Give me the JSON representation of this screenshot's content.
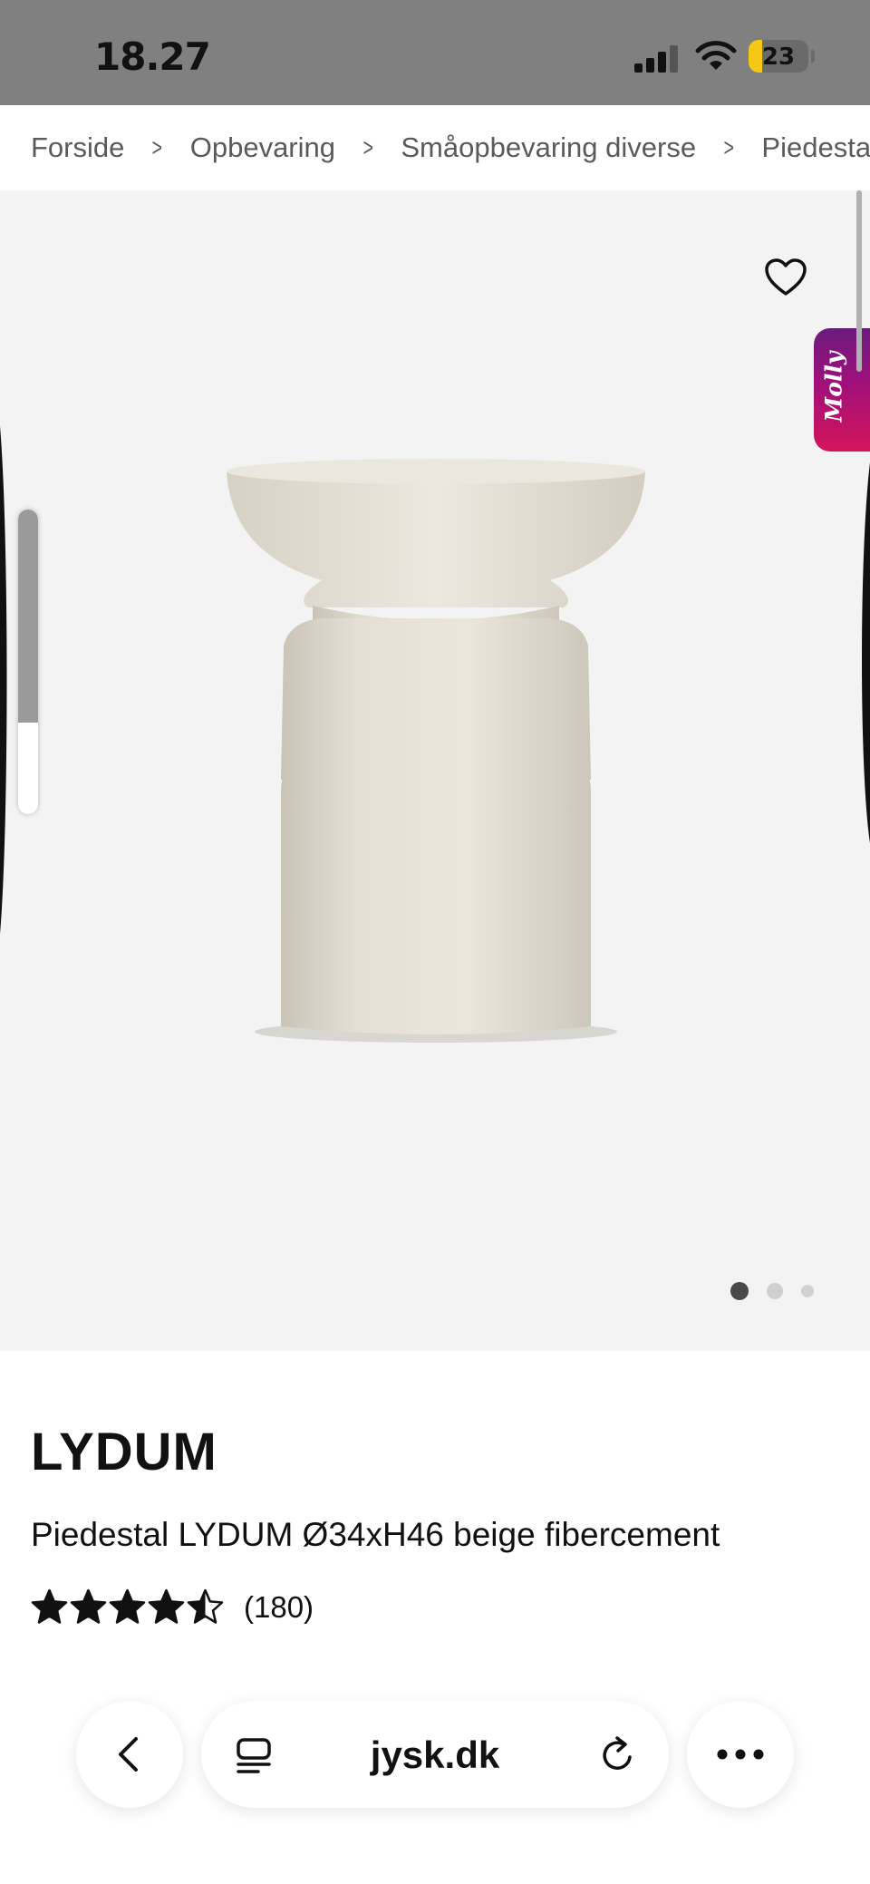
{
  "status_bar": {
    "time": "18.27",
    "battery_level": "23",
    "battery_fraction": 0.23,
    "icons": [
      "signal-icon",
      "wifi-icon",
      "battery-icon"
    ]
  },
  "breadcrumb": {
    "items": [
      "Forside",
      "Opbevaring",
      "Småopbevaring diverse",
      "Piedestal"
    ],
    "separator_icon": "chevron-right-icon"
  },
  "gallery": {
    "favorite_icon": "heart-outline-icon",
    "chat_widget_label": "Molly",
    "chat_widget_colors": [
      "#6a1a7e",
      "#d4145a"
    ],
    "side_scroll_fraction": 0.7,
    "dots": {
      "count": 3,
      "active_index": 0
    }
  },
  "product": {
    "brand": "LYDUM",
    "title": "Piedestal LYDUM Ø34xH46 beige fibercement",
    "rating": 4.5,
    "rating_max": 5,
    "reviews": "(180)"
  },
  "browser": {
    "url": "jysk.dk",
    "icons": [
      "back-icon",
      "reader-icon",
      "reload-icon",
      "more-icon"
    ]
  }
}
